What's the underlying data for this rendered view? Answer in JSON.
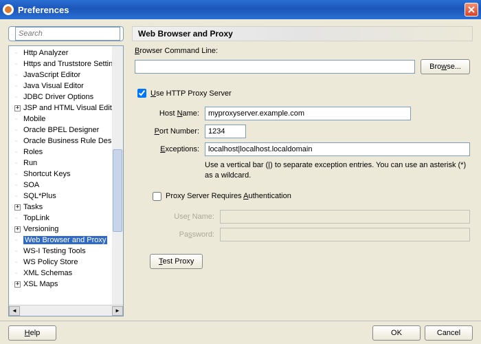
{
  "window": {
    "title": "Preferences"
  },
  "search": {
    "placeholder": "Search"
  },
  "tree": {
    "items": [
      {
        "label": "Http Analyzer",
        "expandable": false
      },
      {
        "label": "Https and Truststore Settin",
        "expandable": false
      },
      {
        "label": "JavaScript Editor",
        "expandable": false
      },
      {
        "label": "Java Visual Editor",
        "expandable": false
      },
      {
        "label": "JDBC Driver Options",
        "expandable": false
      },
      {
        "label": "JSP and HTML Visual Editor",
        "expandable": true
      },
      {
        "label": "Mobile",
        "expandable": false
      },
      {
        "label": "Oracle BPEL Designer",
        "expandable": false
      },
      {
        "label": "Oracle Business Rule Design",
        "expandable": false
      },
      {
        "label": "Roles",
        "expandable": false
      },
      {
        "label": "Run",
        "expandable": false
      },
      {
        "label": "Shortcut Keys",
        "expandable": false
      },
      {
        "label": "SOA",
        "expandable": false
      },
      {
        "label": "SQL*Plus",
        "expandable": false
      },
      {
        "label": "Tasks",
        "expandable": true
      },
      {
        "label": "TopLink",
        "expandable": false
      },
      {
        "label": "Versioning",
        "expandable": true
      },
      {
        "label": "Web Browser and Proxy",
        "expandable": false,
        "selected": true
      },
      {
        "label": "WS-I Testing Tools",
        "expandable": false
      },
      {
        "label": "WS Policy Store",
        "expandable": false
      },
      {
        "label": "XML Schemas",
        "expandable": false
      },
      {
        "label": "XSL Maps",
        "expandable": true
      }
    ]
  },
  "panel": {
    "title": "Web Browser and Proxy",
    "browser_command_label": "Browser Command Line:",
    "browser_command_value": "",
    "browse_button": "Browse...",
    "use_proxy_label": "Use HTTP Proxy Server",
    "use_proxy_checked": true,
    "host_label": "Host Name:",
    "host_value": "myproxyserver.example.com",
    "port_label": "Port Number:",
    "port_value": "1234",
    "exceptions_label": "Exceptions:",
    "exceptions_value": "localhost|localhost.localdomain",
    "exceptions_hint": "Use a vertical bar (|) to separate exception entries.  You can use an asterisk (*) as a wildcard.",
    "requires_auth_label": "Proxy Server Requires Authentication",
    "requires_auth_checked": false,
    "username_label": "User Name:",
    "username_value": "",
    "password_label": "Password:",
    "password_value": "",
    "test_proxy_button": "Test Proxy"
  },
  "bottom": {
    "help": "Help",
    "ok": "OK",
    "cancel": "Cancel"
  }
}
